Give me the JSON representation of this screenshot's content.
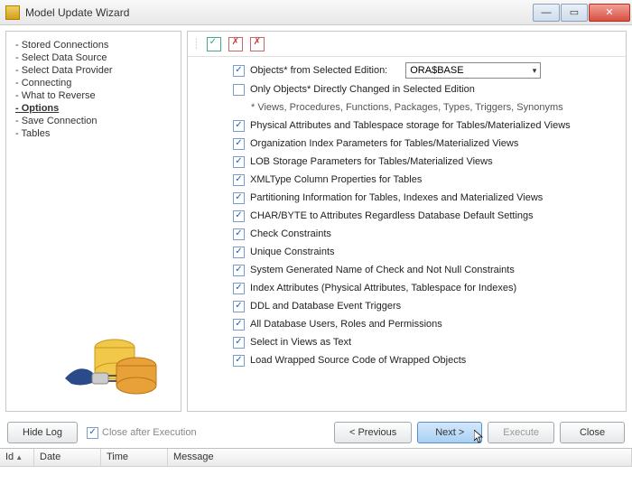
{
  "window": {
    "title": "Model Update Wizard"
  },
  "sidebar": {
    "steps": [
      {
        "label": "Stored Connections",
        "active": false
      },
      {
        "label": "Select Data Source",
        "active": false
      },
      {
        "label": "Select Data Provider",
        "active": false
      },
      {
        "label": "Connecting",
        "active": false
      },
      {
        "label": "What to Reverse",
        "active": false
      },
      {
        "label": "Options",
        "active": true
      },
      {
        "label": "Save Connection",
        "active": false
      },
      {
        "label": "Tables",
        "active": false
      }
    ]
  },
  "options": {
    "sel_edition": {
      "checked": true,
      "label": "Objects* from Selected Edition:",
      "value": "ORA$BASE"
    },
    "only_changed": {
      "checked": false,
      "label": "Only Objects* Directly Changed in Selected Edition"
    },
    "note": "* Views, Procedures, Functions, Packages, Types, Triggers, Synonyms",
    "items": [
      {
        "checked": true,
        "label": "Physical Attributes and Tablespace storage for Tables/Materialized Views"
      },
      {
        "checked": true,
        "label": "Organization Index Parameters for Tables/Materialized Views"
      },
      {
        "checked": true,
        "label": "LOB Storage Parameters for Tables/Materialized Views"
      },
      {
        "checked": true,
        "label": "XMLType Column Properties for Tables"
      },
      {
        "checked": true,
        "label": "Partitioning Information for Tables, Indexes and Materialized Views"
      },
      {
        "checked": true,
        "label": "CHAR/BYTE to Attributes Regardless Database Default Settings"
      },
      {
        "checked": true,
        "label": "Check Constraints"
      },
      {
        "checked": true,
        "label": "Unique Constraints"
      },
      {
        "checked": true,
        "label": "System Generated Name of Check and Not Null Constraints"
      },
      {
        "checked": true,
        "label": "Index Attributes (Physical Attributes, Tablespace for Indexes)"
      },
      {
        "checked": true,
        "label": "DDL and Database Event Triggers"
      },
      {
        "checked": true,
        "label": "All Database Users, Roles and Permissions"
      },
      {
        "checked": true,
        "label": "Select in Views as Text"
      },
      {
        "checked": true,
        "label": "Load Wrapped Source Code of Wrapped Objects"
      }
    ]
  },
  "buttons": {
    "hide_log": "Hide Log",
    "close_after": "Close after Execution",
    "previous": "< Previous",
    "next": "Next >",
    "execute": "Execute",
    "close": "Close"
  },
  "log": {
    "cols": {
      "id": "Id",
      "date": "Date",
      "time": "Time",
      "message": "Message"
    }
  }
}
